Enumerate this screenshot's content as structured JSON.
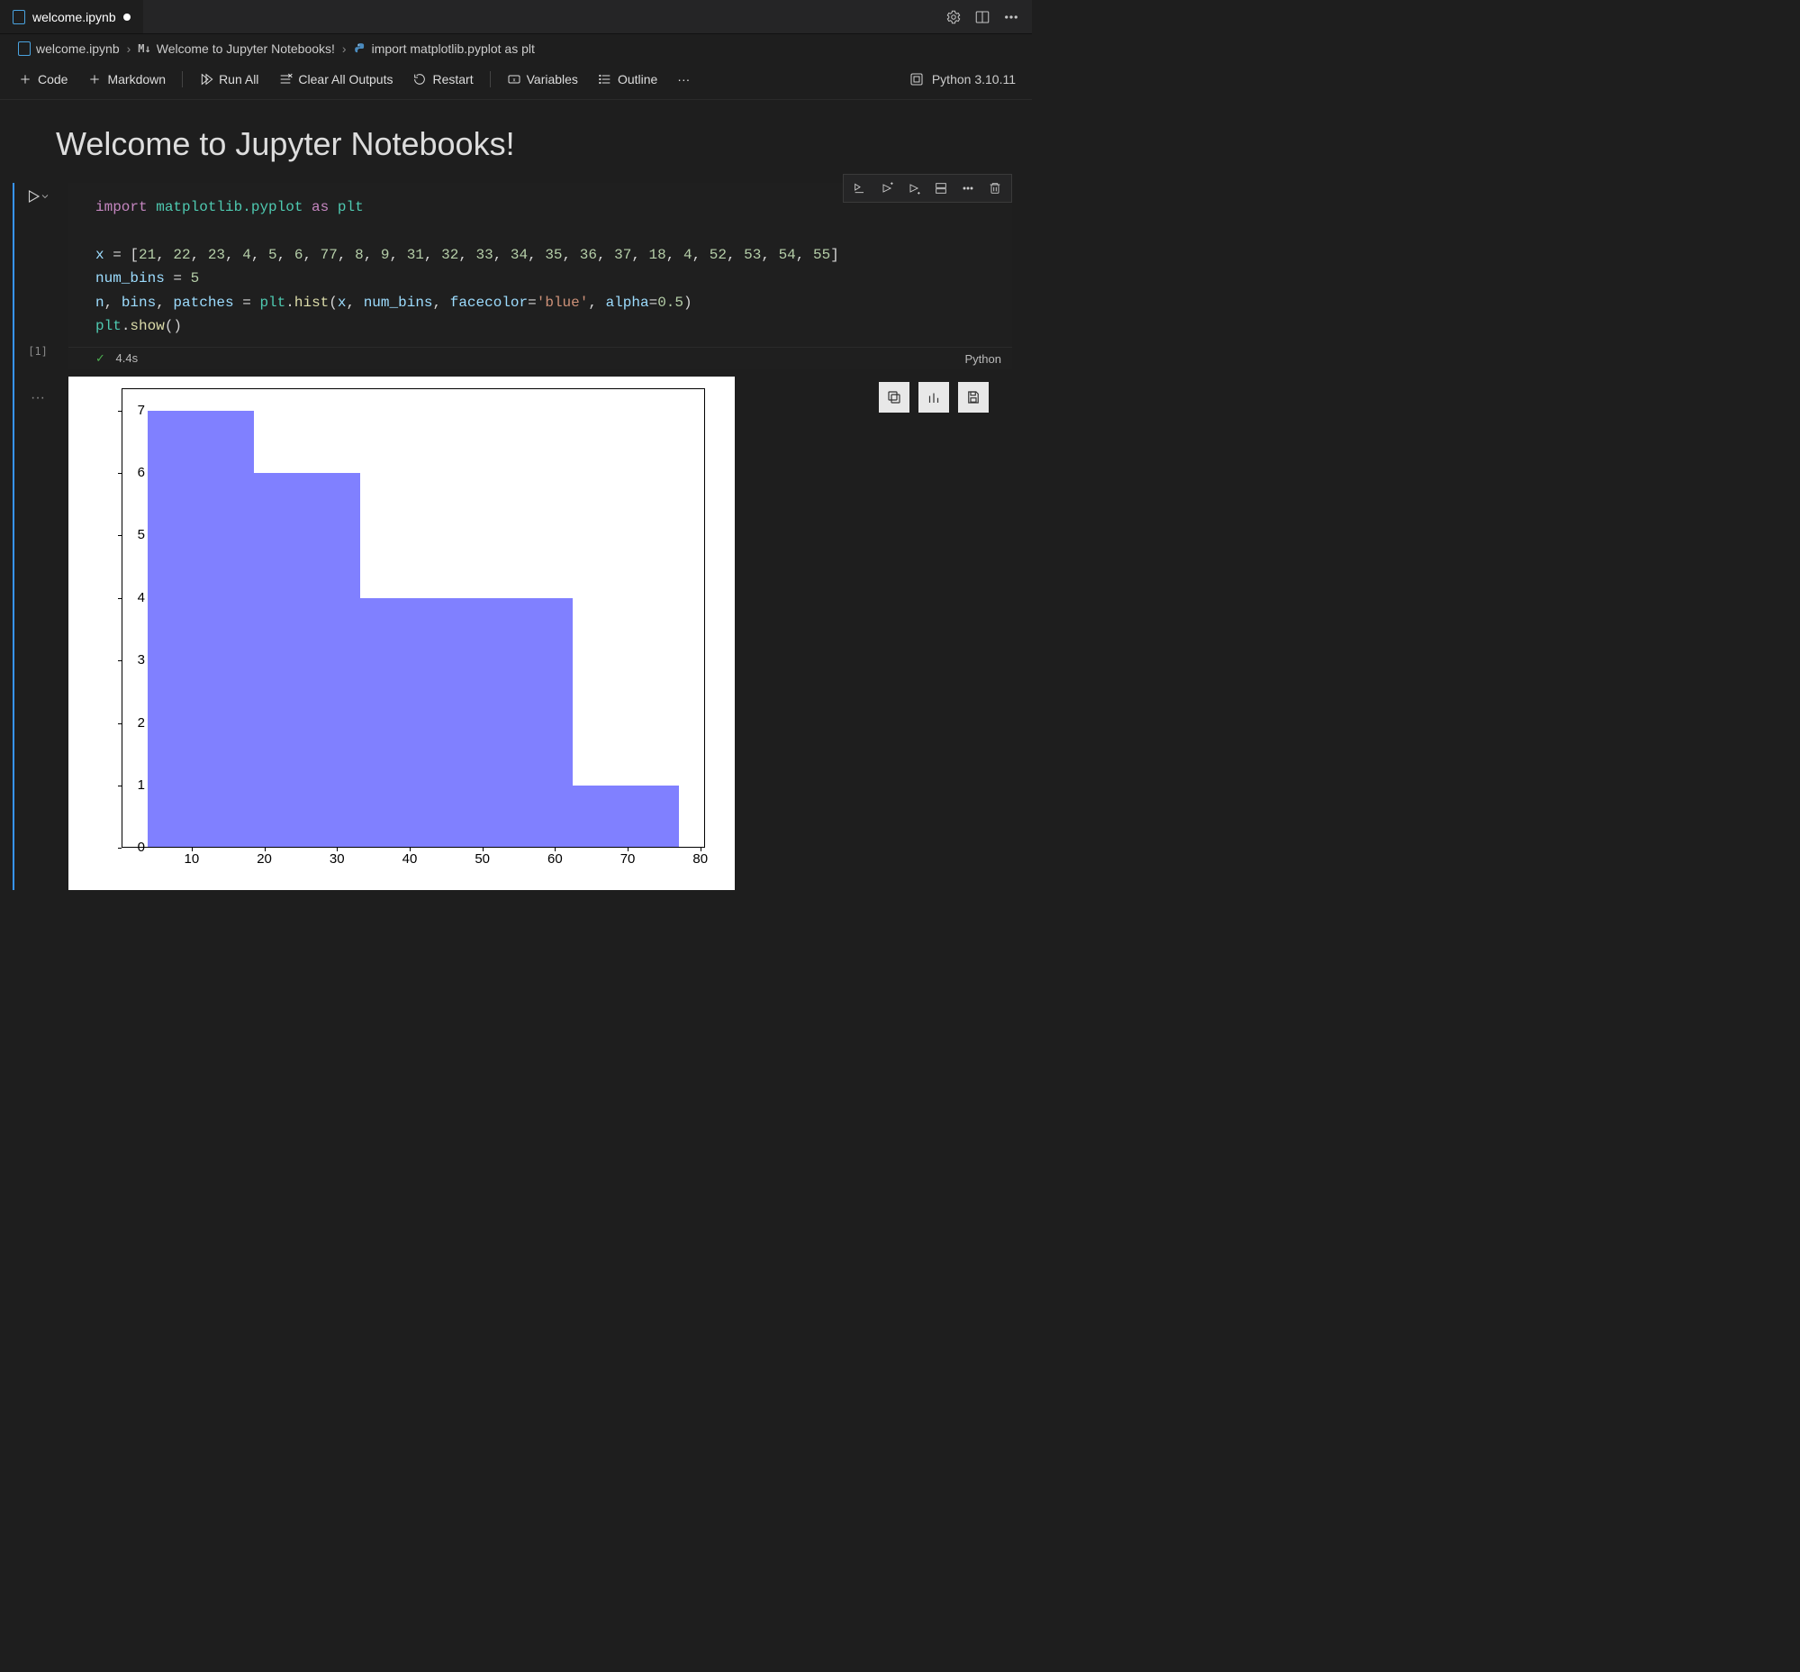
{
  "tab": {
    "title": "welcome.ipynb",
    "dirty": true
  },
  "tab_actions": {
    "settings": "Settings",
    "layout": "Split Editor",
    "more": "More Actions"
  },
  "breadcrumb": {
    "file": "welcome.ipynb",
    "section_prefix": "M↓",
    "section": "Welcome to Jupyter Notebooks!",
    "cell": "import matplotlib.pyplot as plt"
  },
  "toolbar": {
    "code": "Code",
    "markdown": "Markdown",
    "run_all": "Run All",
    "clear": "Clear All Outputs",
    "restart": "Restart",
    "variables": "Variables",
    "outline": "Outline",
    "more": "···",
    "kernel": "Python 3.10.11"
  },
  "heading": "Welcome to Jupyter Notebooks!",
  "cell": {
    "execution_count": "[1]",
    "status_time": "4.4s",
    "status_lang": "Python",
    "code_tokens": [
      [
        "k-imp",
        "import "
      ],
      [
        "k-mod",
        "matplotlib.pyplot"
      ],
      [
        "k-as",
        " as "
      ],
      [
        "k-mod",
        "plt"
      ],
      [
        "",
        "\n\n"
      ],
      [
        "k-nm",
        "x"
      ],
      [
        "",
        " = ["
      ],
      [
        "k-num",
        "21"
      ],
      [
        "",
        ", "
      ],
      [
        "k-num",
        "22"
      ],
      [
        "",
        ", "
      ],
      [
        "k-num",
        "23"
      ],
      [
        "",
        ", "
      ],
      [
        "k-num",
        "4"
      ],
      [
        "",
        ", "
      ],
      [
        "k-num",
        "5"
      ],
      [
        "",
        ", "
      ],
      [
        "k-num",
        "6"
      ],
      [
        "",
        ", "
      ],
      [
        "k-num",
        "77"
      ],
      [
        "",
        ", "
      ],
      [
        "k-num",
        "8"
      ],
      [
        "",
        ", "
      ],
      [
        "k-num",
        "9"
      ],
      [
        "",
        ", "
      ],
      [
        "k-num",
        "31"
      ],
      [
        "",
        ", "
      ],
      [
        "k-num",
        "32"
      ],
      [
        "",
        ", "
      ],
      [
        "k-num",
        "33"
      ],
      [
        "",
        ", "
      ],
      [
        "k-num",
        "34"
      ],
      [
        "",
        ", "
      ],
      [
        "k-num",
        "35"
      ],
      [
        "",
        ", "
      ],
      [
        "k-num",
        "36"
      ],
      [
        "",
        ", "
      ],
      [
        "k-num",
        "37"
      ],
      [
        "",
        ", "
      ],
      [
        "k-num",
        "18"
      ],
      [
        "",
        ", "
      ],
      [
        "k-num",
        "4"
      ],
      [
        "",
        ", "
      ],
      [
        "k-num",
        "52"
      ],
      [
        "",
        ", "
      ],
      [
        "k-num",
        "53"
      ],
      [
        "",
        ", "
      ],
      [
        "k-num",
        "54"
      ],
      [
        "",
        ", "
      ],
      [
        "k-num",
        "55"
      ],
      [
        "",
        "]\n"
      ],
      [
        "k-nm",
        "num_bins"
      ],
      [
        "",
        " = "
      ],
      [
        "k-num",
        "5"
      ],
      [
        "",
        "\n"
      ],
      [
        "k-nm",
        "n"
      ],
      [
        "",
        ", "
      ],
      [
        "k-nm",
        "bins"
      ],
      [
        "",
        ", "
      ],
      [
        "k-nm",
        "patches"
      ],
      [
        "",
        " = "
      ],
      [
        "k-mod",
        "plt"
      ],
      [
        "",
        "."
      ],
      [
        "k-fn",
        "hist"
      ],
      [
        "",
        "("
      ],
      [
        "k-nm",
        "x"
      ],
      [
        "",
        ", "
      ],
      [
        "k-nm",
        "num_bins"
      ],
      [
        "",
        ", "
      ],
      [
        "k-par",
        "facecolor"
      ],
      [
        "",
        "="
      ],
      [
        "k-str",
        "'blue'"
      ],
      [
        "",
        ", "
      ],
      [
        "k-par",
        "alpha"
      ],
      [
        "",
        "="
      ],
      [
        "k-num",
        "0.5"
      ],
      [
        "",
        ")\n"
      ],
      [
        "k-mod",
        "plt"
      ],
      [
        "",
        "."
      ],
      [
        "k-fn",
        "show"
      ],
      [
        "",
        "()"
      ]
    ]
  },
  "cell_toolbar": {
    "run_by_line": "Run by Line",
    "execute_above": "Execute Above",
    "execute_below": "Execute Below",
    "split": "Split Cell",
    "more": "More",
    "delete": "Delete Cell"
  },
  "output_toolbar": {
    "copy": "Copy",
    "chart": "Expand Image",
    "save": "Save"
  },
  "chart_data": {
    "type": "bar",
    "description": "Histogram of x with 5 bins",
    "bin_edges": [
      4.0,
      18.6,
      33.2,
      47.8,
      62.4,
      77.0
    ],
    "values": [
      7,
      6,
      4,
      4,
      1
    ],
    "x_ticks": [
      10,
      20,
      30,
      40,
      50,
      60,
      70,
      80
    ],
    "y_ticks": [
      0,
      1,
      2,
      3,
      4,
      5,
      6,
      7
    ],
    "xlim": [
      0.35,
      80.65
    ],
    "ylim": [
      0,
      7.35
    ],
    "facecolor": "#8080ff",
    "alpha": 0.5
  }
}
